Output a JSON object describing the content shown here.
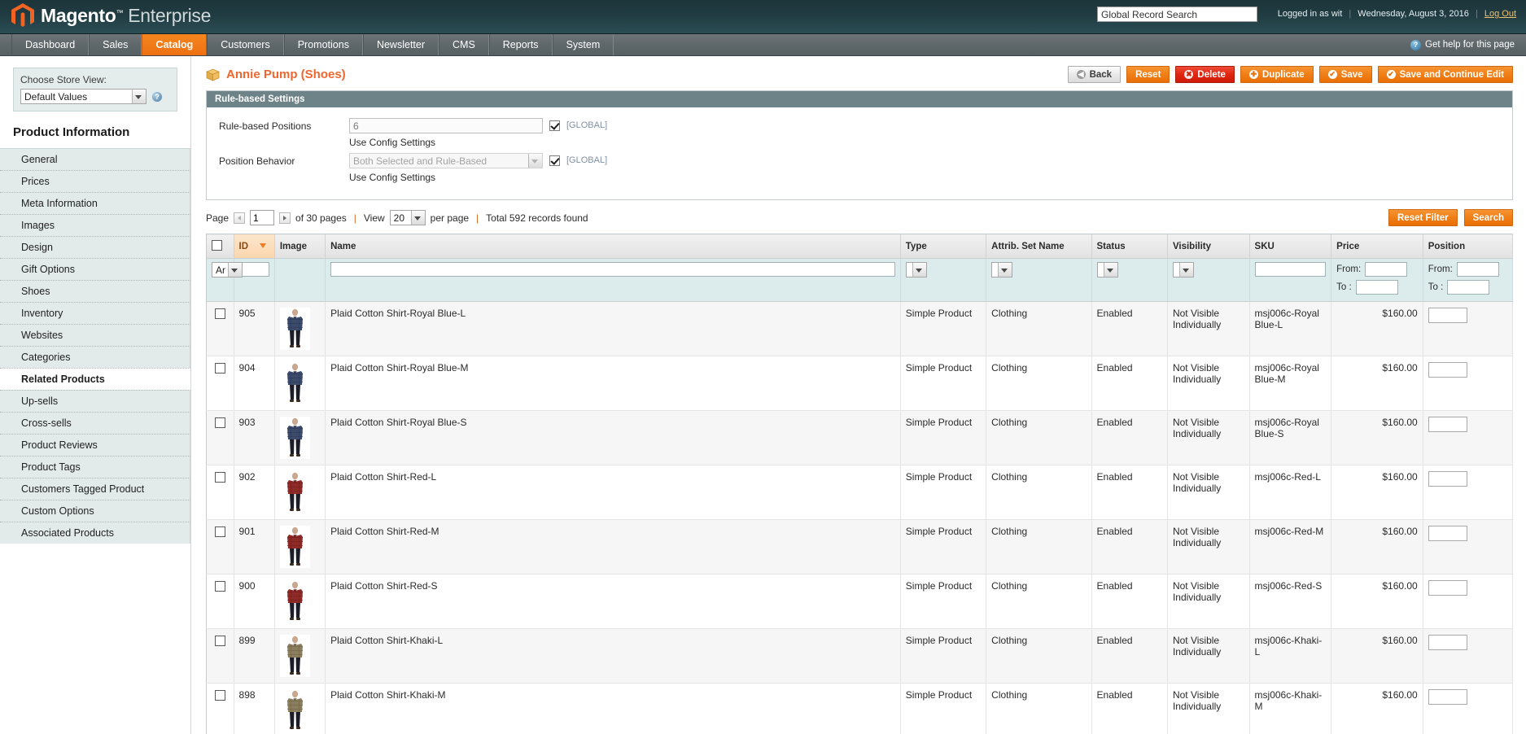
{
  "header": {
    "logo_brand": "Magento",
    "logo_tm": "™",
    "logo_suffix": "Enterprise",
    "search_value": "Global Record Search",
    "search_placeholder": "Global Record Search",
    "logged_in_as": "Logged in as wit",
    "date": "Wednesday, August 3, 2016",
    "logout": "Log Out",
    "sep": "|"
  },
  "nav": {
    "items": [
      {
        "label": "Dashboard",
        "active": false
      },
      {
        "label": "Sales",
        "active": false
      },
      {
        "label": "Catalog",
        "active": true
      },
      {
        "label": "Customers",
        "active": false
      },
      {
        "label": "Promotions",
        "active": false
      },
      {
        "label": "Newsletter",
        "active": false
      },
      {
        "label": "CMS",
        "active": false
      },
      {
        "label": "Reports",
        "active": false
      },
      {
        "label": "System",
        "active": false
      }
    ],
    "help_label": "Get help for this page",
    "help_icon": "?"
  },
  "sidebar": {
    "store_view_label": "Choose Store View:",
    "store_view_value": "Default Values",
    "help_icon": "?",
    "title": "Product Information",
    "items": [
      {
        "label": "General",
        "active": false
      },
      {
        "label": "Prices",
        "active": false
      },
      {
        "label": "Meta Information",
        "active": false
      },
      {
        "label": "Images",
        "active": false
      },
      {
        "label": "Design",
        "active": false
      },
      {
        "label": "Gift Options",
        "active": false
      },
      {
        "label": "Shoes",
        "active": false
      },
      {
        "label": "Inventory",
        "active": false
      },
      {
        "label": "Websites",
        "active": false
      },
      {
        "label": "Categories",
        "active": false
      },
      {
        "label": "Related Products",
        "active": true
      },
      {
        "label": "Up-sells",
        "active": false
      },
      {
        "label": "Cross-sells",
        "active": false
      },
      {
        "label": "Product Reviews",
        "active": false
      },
      {
        "label": "Product Tags",
        "active": false
      },
      {
        "label": "Customers Tagged Product",
        "active": false
      },
      {
        "label": "Custom Options",
        "active": false
      },
      {
        "label": "Associated Products",
        "active": false
      }
    ]
  },
  "page": {
    "title": "Annie Pump (Shoes)",
    "buttons": {
      "back": "Back",
      "reset": "Reset",
      "delete": "Delete",
      "duplicate": "Duplicate",
      "save": "Save",
      "save_continue": "Save and Continue Edit"
    }
  },
  "rule_settings": {
    "legend": "Rule-based Settings",
    "positions_label": "Rule-based Positions",
    "positions_value": "6",
    "positions_scope": "[GLOBAL]",
    "positions_use_config": "Use Config Settings",
    "behavior_label": "Position Behavior",
    "behavior_value": "Both Selected and Rule-Based",
    "behavior_scope": "[GLOBAL]",
    "behavior_use_config": "Use Config Settings"
  },
  "pager": {
    "page_word": "Page",
    "page_value": "1",
    "of_pages": "of 30 pages",
    "sep1": "|",
    "view_word": "View",
    "per_page_value": "20",
    "per_page_word": "per page",
    "sep2": "|",
    "total": "Total 592 records found",
    "reset_filter": "Reset Filter",
    "search": "Search"
  },
  "grid": {
    "columns": [
      "ID",
      "Image",
      "Name",
      "Type",
      "Attrib. Set Name",
      "Status",
      "Visibility",
      "SKU",
      "Price",
      "Position"
    ],
    "sorted_column": "ID",
    "sort_dir": "desc",
    "filters": {
      "checkbox_select": "Any",
      "id": "",
      "name": "",
      "type": "",
      "attrib_set": "",
      "status": "",
      "visibility": "",
      "sku": "",
      "price_from_label": "From:",
      "price_to_label": "To :",
      "price_from": "",
      "price_to": "",
      "position_from_label": "From:",
      "position_to_label": "To :",
      "position_from": "",
      "position_to": ""
    },
    "rows": [
      {
        "id": "905",
        "name": "Plaid Cotton Shirt-Royal Blue-L",
        "type": "Simple Product",
        "attrib_set": "Clothing",
        "status": "Enabled",
        "visibility": "Not Visible Individually",
        "sku": "msj006c-Royal Blue-L",
        "price": "$160.00",
        "position": "",
        "img": "blue"
      },
      {
        "id": "904",
        "name": "Plaid Cotton Shirt-Royal Blue-M",
        "type": "Simple Product",
        "attrib_set": "Clothing",
        "status": "Enabled",
        "visibility": "Not Visible Individually",
        "sku": "msj006c-Royal Blue-M",
        "price": "$160.00",
        "position": "",
        "img": "blue"
      },
      {
        "id": "903",
        "name": "Plaid Cotton Shirt-Royal Blue-S",
        "type": "Simple Product",
        "attrib_set": "Clothing",
        "status": "Enabled",
        "visibility": "Not Visible Individually",
        "sku": "msj006c-Royal Blue-S",
        "price": "$160.00",
        "position": "",
        "img": "blue"
      },
      {
        "id": "902",
        "name": "Plaid Cotton Shirt-Red-L",
        "type": "Simple Product",
        "attrib_set": "Clothing",
        "status": "Enabled",
        "visibility": "Not Visible Individually",
        "sku": "msj006c-Red-L",
        "price": "$160.00",
        "position": "",
        "img": "red"
      },
      {
        "id": "901",
        "name": "Plaid Cotton Shirt-Red-M",
        "type": "Simple Product",
        "attrib_set": "Clothing",
        "status": "Enabled",
        "visibility": "Not Visible Individually",
        "sku": "msj006c-Red-M",
        "price": "$160.00",
        "position": "",
        "img": "red"
      },
      {
        "id": "900",
        "name": "Plaid Cotton Shirt-Red-S",
        "type": "Simple Product",
        "attrib_set": "Clothing",
        "status": "Enabled",
        "visibility": "Not Visible Individually",
        "sku": "msj006c-Red-S",
        "price": "$160.00",
        "position": "",
        "img": "red"
      },
      {
        "id": "899",
        "name": "Plaid Cotton Shirt-Khaki-L",
        "type": "Simple Product",
        "attrib_set": "Clothing",
        "status": "Enabled",
        "visibility": "Not Visible Individually",
        "sku": "msj006c-Khaki-L",
        "price": "$160.00",
        "position": "",
        "img": "khaki"
      },
      {
        "id": "898",
        "name": "Plaid Cotton Shirt-Khaki-M",
        "type": "Simple Product",
        "attrib_set": "Clothing",
        "status": "Enabled",
        "visibility": "Not Visible Individually",
        "sku": "msj006c-Khaki-M",
        "price": "$160.00",
        "position": "",
        "img": "khaki"
      }
    ]
  },
  "colors": {
    "accent_orange": "#ef672f",
    "nav_active": "#ee6f12",
    "header_dark": "#203c42",
    "fieldset_head": "#6e8387",
    "filter_row": "#dcebec",
    "scope_tag": "#8191a5"
  }
}
